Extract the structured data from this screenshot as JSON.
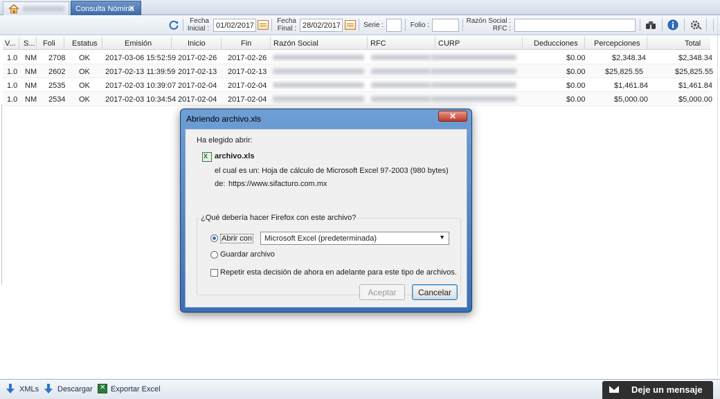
{
  "tabs": {
    "active_label": "Consulta Nómina",
    "close_glyph": "✕"
  },
  "toolbar": {
    "fecha_inicial_label_1": "Fecha",
    "fecha_inicial_label_2": "Inicial :",
    "fecha_inicial_value": "01/02/2017",
    "fecha_final_label_1": "Fecha",
    "fecha_final_label_2": "Final :",
    "fecha_final_value": "28/02/2017",
    "serie_label": "Serie :",
    "serie_value": "",
    "folio_label": "Folio :",
    "folio_value": "",
    "razon_label_1": "Razón Social :",
    "razon_label_2": "RFC :",
    "razon_value": "",
    "icons": [
      "refresh-icon",
      "calendar-icon",
      "binoculars-icon",
      "info-icon",
      "settings-icon"
    ]
  },
  "table": {
    "headers": [
      "V...",
      "S...",
      "Foli",
      "Estatus",
      "Emisión",
      "Inicio",
      "Fin",
      "Razón Social",
      "RFC",
      "CURP",
      "Deducciones",
      "Percepciones",
      "Total"
    ],
    "rows": [
      [
        "1.0",
        "NM",
        "2708",
        "OK",
        "2017-03-06 15:52:59",
        "2017-02-26",
        "2017-02-26",
        "$0.00",
        "$2,348.34",
        "$2,348.34"
      ],
      [
        "1.0",
        "NM",
        "2602",
        "OK",
        "2017-02-13 11:39:59",
        "2017-02-13",
        "2017-02-13",
        "$0.00",
        "$25,825.55",
        "$25,825.55"
      ],
      [
        "1.0",
        "NM",
        "2535",
        "OK",
        "2017-02-03 10:39:07",
        "2017-02-04",
        "2017-02-04",
        "$0.00",
        "$1,461.84",
        "$1,461.84"
      ],
      [
        "1.0",
        "NM",
        "2534",
        "OK",
        "2017-02-03 10:34:54",
        "2017-02-04",
        "2017-02-04",
        "$0.00",
        "$5,000.00",
        "$5,000.00"
      ]
    ]
  },
  "bottombar": {
    "xmls_label": "XMLs",
    "descargar_label": "Descargar",
    "exportar_label": "Exportar Excel",
    "message_label": "Deje un mensaje"
  },
  "dialog": {
    "title": "Abriendo archivo.xls",
    "close_glyph": "✕",
    "intro": "Ha elegido abrir:",
    "filename": "archivo.xls",
    "type_label": "el cual es un:",
    "type_value": "Hoja de cálculo de Microsoft Excel 97-2003 (980 bytes)",
    "from_label": "de:",
    "from_value": "https://www.sifacturo.com.mx",
    "question": "¿Qué debería hacer Firefox con este archivo?",
    "open_with_label": "Abrir con",
    "open_with_app": "Microsoft Excel (predeterminada)",
    "save_label": "Guardar archivo",
    "remember_label": "Repetir esta decisión de ahora en adelante para este tipo de archivos.",
    "accept_label": "Aceptar",
    "cancel_label": "Cancelar"
  },
  "colors": {
    "accent": "#3e6aa6",
    "dialog_frame": "#3a6fb3",
    "message_bg": "#2f2f2f"
  }
}
